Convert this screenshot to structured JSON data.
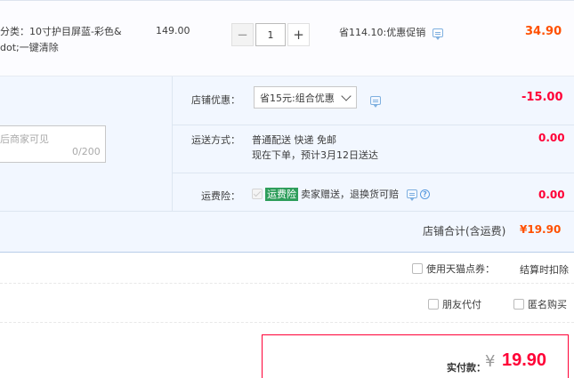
{
  "item": {
    "desc_line1": "分类：10寸护目屏蓝-彩色&",
    "desc_line2": "dot;一键清除",
    "price": "149.00",
    "qty": "1",
    "qty_minus": "−",
    "qty_plus": "+",
    "promo": "省114.10:优惠促销",
    "total": "34.90"
  },
  "shop": {
    "discount_label": "店铺优惠：",
    "discount_selected": "省15元:组合优惠",
    "discount_amount": "-15.00",
    "shipping_label": "运送方式：",
    "shipping_line1": "普通配送 快递 免邮",
    "shipping_line2": "现在下单，预计3月12日送达",
    "shipping_amount": "0.00",
    "insurance_label": "运费险：",
    "insurance_badge": "运费险",
    "insurance_text": "卖家赠送，退换货可赔",
    "insurance_amount": "0.00",
    "message_placeholder": "后商家可见",
    "message_count": "0/200",
    "total_label": "店铺合计(含运费)",
    "total_value": "¥19.90"
  },
  "options": {
    "tmall_points_label": "使用天猫点券：",
    "tmall_points_note": "结算时扣除",
    "friend_pay_label": "朋友代付",
    "anonymous_label": "匿名购买"
  },
  "payment": {
    "label": "实付款：",
    "currency": "¥",
    "amount": "19.90"
  },
  "colors": {
    "accent_red": "#ff0036",
    "accent_orange": "#ff5000",
    "panel_blue": "#f2f7ff",
    "badge_green": "#2e9e5b"
  }
}
